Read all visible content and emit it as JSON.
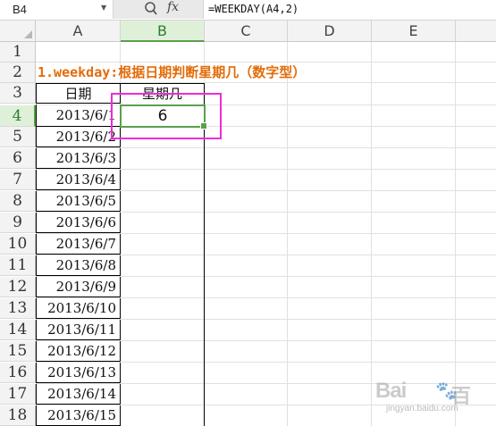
{
  "formula_bar": {
    "name_box": "B4",
    "fx_label": "fx",
    "formula": "=WEEKDAY(A4,2)"
  },
  "columns": [
    "A",
    "B",
    "C",
    "D",
    "E"
  ],
  "rows": [
    "1",
    "2",
    "3",
    "4",
    "5",
    "6",
    "7",
    "8",
    "9",
    "10",
    "11",
    "12",
    "13",
    "14",
    "15",
    "16",
    "17",
    "18"
  ],
  "sheet": {
    "title": "1.weekday:根据日期判断星期几（数字型）",
    "header_date": "日期",
    "header_weekday": "星期几",
    "result_b4": "6",
    "dates": [
      "2013/6/1",
      "2013/6/2",
      "2013/6/3",
      "2013/6/4",
      "2013/6/5",
      "2013/6/6",
      "2013/6/7",
      "2013/6/8",
      "2013/6/9",
      "2013/6/10",
      "2013/6/11",
      "2013/6/12",
      "2013/6/13",
      "2013/6/14",
      "2013/6/15"
    ]
  },
  "colors": {
    "title": "#e36c09",
    "selection": "#5aa04a",
    "highlight_box": "#ee2cd8"
  },
  "watermark": {
    "logo_text": "Bai",
    "logo_text2": "百",
    "sub": "jingyan.baidu.com"
  }
}
